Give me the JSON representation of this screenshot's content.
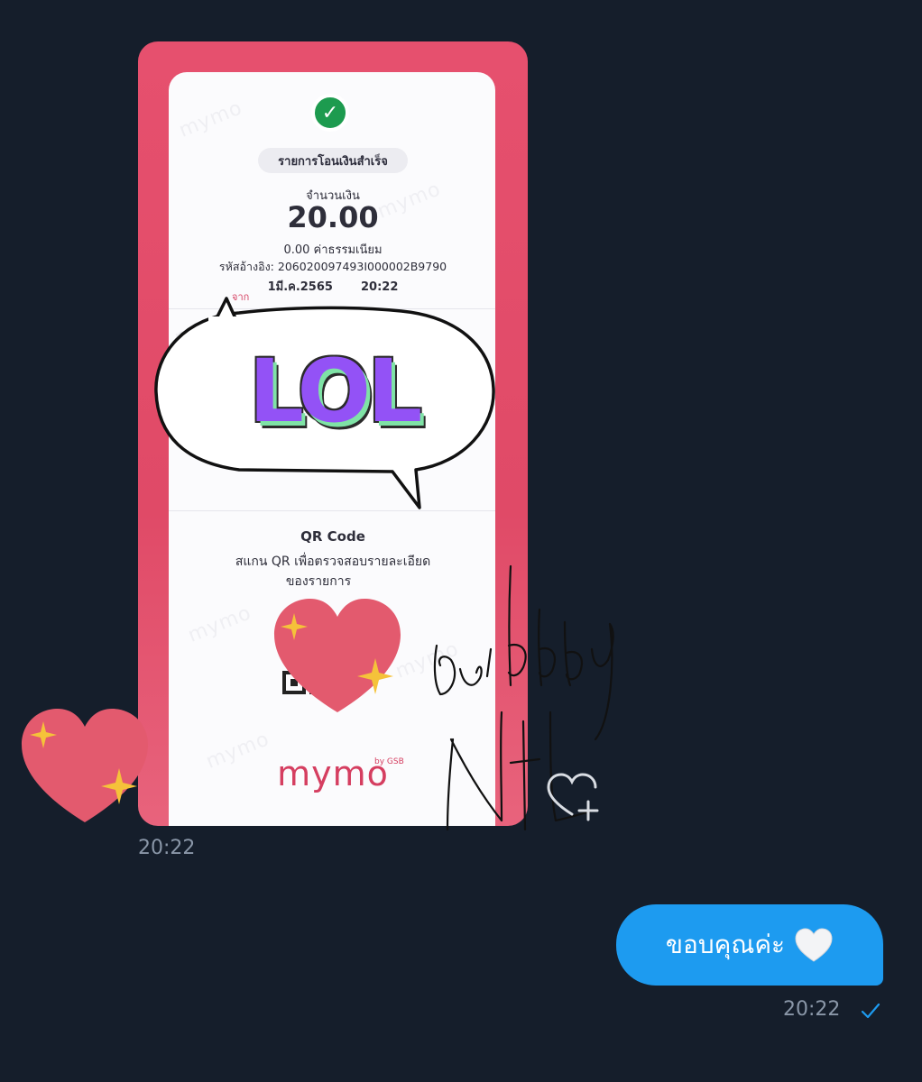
{
  "chat": {
    "received": {
      "receipt": {
        "status_title": "รายการโอนเงินสำเร็จ",
        "amount_label": "จำนวนเงิน",
        "amount": "20.00",
        "fee": "0.00 ค่าธรรมเนียม",
        "reference_label": "รหัสอ้างอิง:",
        "reference": "206020097493I000002B9790",
        "date": "1มี.ค.2565",
        "time": "20:22",
        "from_label": "จาก",
        "qr_title": "QR Code",
        "qr_description_line1": "สแกน QR เพื่อตรวจสอบรายละเอียด",
        "qr_description_line2": "ของรายการ",
        "brand": "mymo",
        "brand_sub": "by GSB",
        "watermark": "mymo"
      },
      "sticker_text": "LOL",
      "timestamp": "20:22"
    },
    "sent": {
      "text": "ขอบคุณค่ะ",
      "timestamp": "20:22",
      "status": "read"
    }
  },
  "colors": {
    "background": "#151e2b",
    "bubble_out": "#1d9bf0",
    "receipt_frame": "#e6506e",
    "success": "#1d9b4f",
    "timestamp": "#8a97a8",
    "lol_purple": "#9352f6",
    "lol_green": "#7fe3a6",
    "heart": "#e35a6e",
    "sparkle": "#f5c23a"
  },
  "icons": [
    "check-icon",
    "heart-sparkle-icon",
    "white-heart-icon",
    "react-heart-plus-icon",
    "read-tick-icon",
    "qr-code-icon"
  ]
}
